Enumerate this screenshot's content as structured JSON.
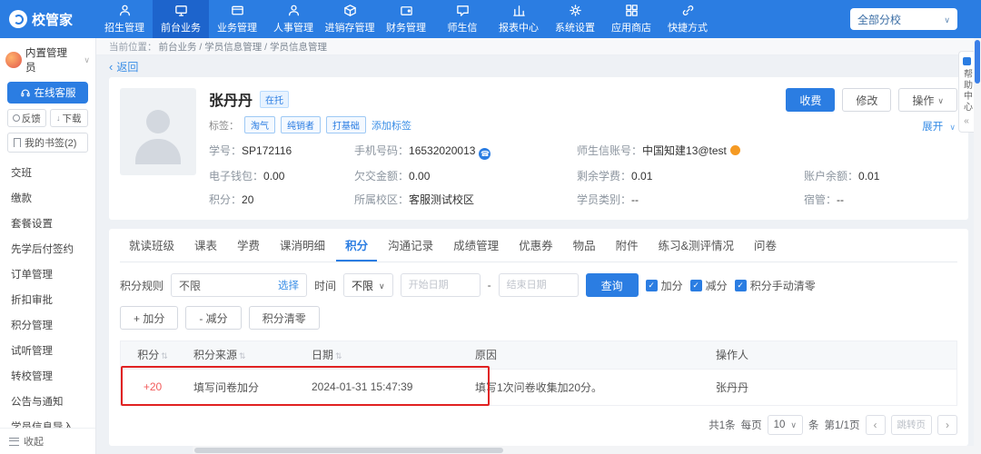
{
  "colors": {
    "primary": "#2b7de2",
    "primary_dark": "#1d64cc",
    "link": "#3a8ee6",
    "danger": "#f25c5c",
    "annotation_red": "#e02121"
  },
  "topbar": {
    "logo": "校管家",
    "branch": "全部分校",
    "nav": [
      {
        "label": "招生管理",
        "icon": "person-icon"
      },
      {
        "label": "前台业务",
        "icon": "monitor-icon",
        "active": true
      },
      {
        "label": "业务管理",
        "icon": "card-icon"
      },
      {
        "label": "人事管理",
        "icon": "person-icon"
      },
      {
        "label": "进销存管理",
        "icon": "box-icon"
      },
      {
        "label": "财务管理",
        "icon": "wallet-icon"
      },
      {
        "label": "师生信",
        "icon": "chat-icon"
      },
      {
        "label": "报表中心",
        "icon": "chart-icon"
      },
      {
        "label": "系统设置",
        "icon": "gear-icon"
      },
      {
        "label": "应用商店",
        "icon": "grid-icon"
      },
      {
        "label": "快捷方式",
        "icon": "link-icon"
      }
    ]
  },
  "sidebar": {
    "user": "内置管理员",
    "online_service": "在线客服",
    "feedback": "反馈",
    "download": "下载",
    "bookmarks": "我的书签(2)",
    "items": [
      {
        "label": "交班"
      },
      {
        "label": "缴款"
      },
      {
        "label": "套餐设置"
      },
      {
        "label": "先学后付签约"
      },
      {
        "label": "订单管理"
      },
      {
        "label": "折扣审批"
      },
      {
        "label": "积分管理"
      },
      {
        "label": "试听管理"
      },
      {
        "label": "转校管理"
      },
      {
        "label": "公告与通知"
      },
      {
        "label": "学员信息导入"
      }
    ],
    "collapse": "收起"
  },
  "breadcrumb": {
    "prefix": "当前位置：",
    "path": "前台业务 / 学员信息管理 / 学员信息管理",
    "back": "返回"
  },
  "student": {
    "name": "张丹丹",
    "status": "在托",
    "tags_label": "标签：",
    "tags": [
      {
        "label": "淘气"
      },
      {
        "label": "纯销者"
      },
      {
        "label": "打基础"
      }
    ],
    "add_tag": "添加标签",
    "rows": [
      [
        {
          "label": "学号：",
          "value": "SP172116"
        },
        {
          "label": "手机号码：",
          "value": "16532020013"
        },
        {
          "label": "师生信账号：",
          "value": "中国知建13@test"
        },
        {
          "label": "",
          "value": ""
        }
      ],
      [
        {
          "label": "电子钱包：",
          "value": "0.00"
        },
        {
          "label": "欠交金额：",
          "value": "0.00"
        },
        {
          "label": "剩余学费：",
          "value": "0.01"
        },
        {
          "label": "账户余额：",
          "value": "0.01"
        }
      ],
      [
        {
          "label": "积分：",
          "value": "20"
        },
        {
          "label": "所属校区：",
          "value": "客服测试校区"
        },
        {
          "label": "学员类别：",
          "value": "--"
        },
        {
          "label": "宿管：",
          "value": "--"
        }
      ]
    ],
    "buttons": {
      "charge": "收费",
      "edit": "修改",
      "action": "操作",
      "expand": "展开"
    }
  },
  "tabs": [
    {
      "label": "就读班级"
    },
    {
      "label": "课表"
    },
    {
      "label": "学费"
    },
    {
      "label": "课消明细"
    },
    {
      "label": "积分"
    },
    {
      "label": "沟通记录"
    },
    {
      "label": "成绩管理"
    },
    {
      "label": "优惠券"
    },
    {
      "label": "物品"
    },
    {
      "label": "附件"
    },
    {
      "label": "练习&测评情况"
    },
    {
      "label": "问卷"
    }
  ],
  "filter": {
    "rule_label": "积分规则",
    "rule_value": "不限",
    "rule_action": "选择",
    "time_label": "时间",
    "time_value": "不限",
    "start_placeholder": "开始日期",
    "dash": "-",
    "end_placeholder": "结束日期",
    "search": "查询",
    "checks": [
      {
        "label": "加分"
      },
      {
        "label": "减分"
      },
      {
        "label": "积分手动清零"
      }
    ]
  },
  "actions": [
    {
      "label": "+ 加分"
    },
    {
      "label": "- 减分"
    },
    {
      "label": "积分清零"
    }
  ],
  "table": {
    "headers": [
      {
        "label": "积分"
      },
      {
        "label": "积分来源"
      },
      {
        "label": "日期"
      },
      {
        "label": "原因"
      },
      {
        "label": "操作人"
      }
    ],
    "rows": [
      {
        "score": "+20",
        "source": "填写问卷加分",
        "date": "2024-01-31 15:47:39",
        "reason": "填写1次问卷收集加20分。",
        "operator": "张丹丹"
      }
    ]
  },
  "pagination": {
    "total": "共1条",
    "per_page_label": "每页",
    "per_page": "10",
    "unit": "条",
    "page": "第1/1页",
    "prev": "‹",
    "next": "›",
    "jump": "跳转页"
  },
  "help": {
    "label": "帮助中心"
  }
}
